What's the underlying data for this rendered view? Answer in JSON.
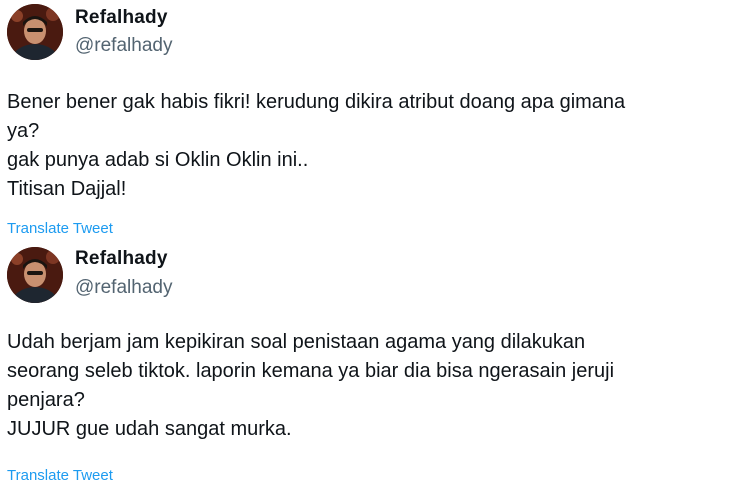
{
  "tweets": [
    {
      "author_name": "Refalhady",
      "handle": "@refalhady",
      "lines": [
        "Bener bener gak habis fikri! kerudung dikira atribut doang apa gimana",
        "ya?",
        "gak punya adab si Oklin Oklin ini..",
        "Titisan Dajjal!"
      ],
      "translate_label": "Translate Tweet"
    },
    {
      "author_name": "Refalhady",
      "handle": "@refalhady",
      "lines": [
        "Udah berjam jam kepikiran soal penistaan agama yang dilakukan",
        "seorang seleb tiktok. laporin kemana ya biar dia bisa ngerasain jeruji",
        "penjara?",
        "JUJUR gue udah sangat murka."
      ],
      "translate_label": "Translate Tweet"
    }
  ],
  "colors": {
    "link": "#1d9bf0",
    "secondary_text": "#536471",
    "primary_text": "#0f1419"
  }
}
